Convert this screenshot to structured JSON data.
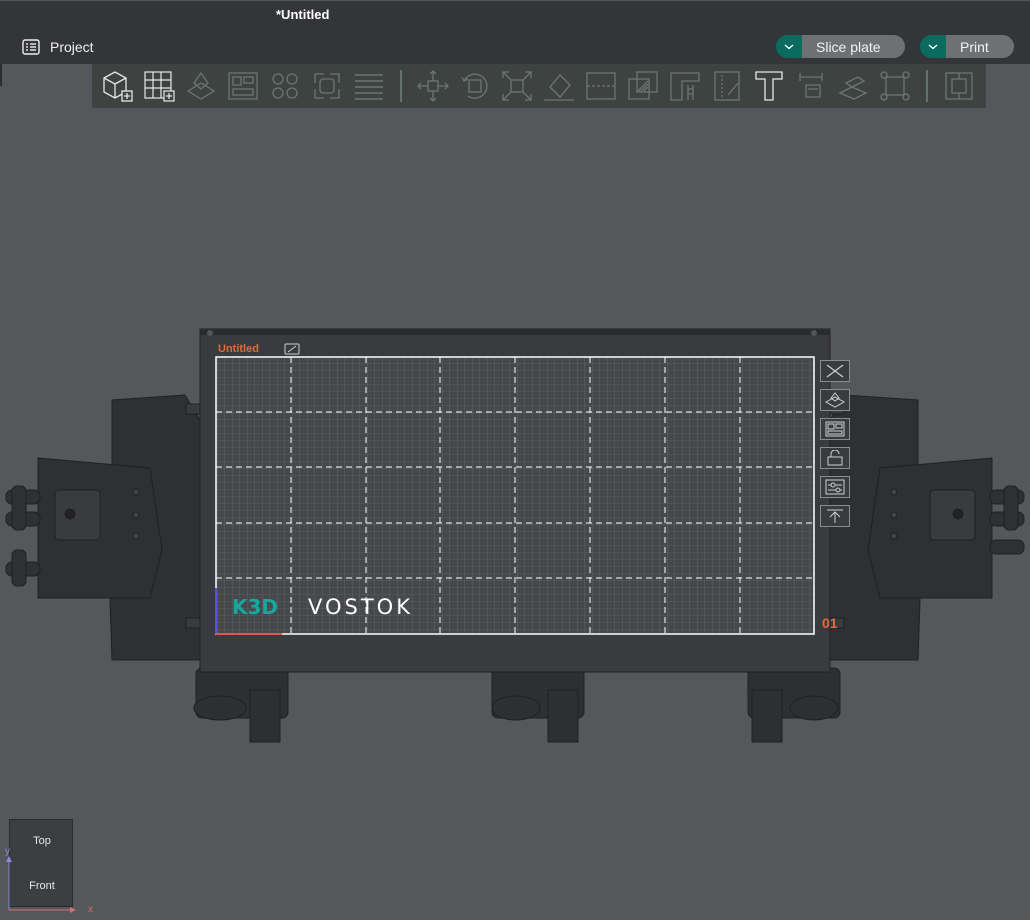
{
  "window": {
    "title": "*Untitled"
  },
  "menu": {
    "project_label": "Project"
  },
  "actions": {
    "slice_label": "Slice plate",
    "print_label": "Print"
  },
  "toolbar": {
    "icons": [
      "add-cube-icon",
      "add-plate-icon",
      "auto-orient-icon",
      "arrange-icon",
      "split-objects-icon",
      "split-parts-icon",
      "layers-list-icon",
      "move-icon",
      "rotate-icon",
      "scale-icon",
      "lay-on-face-icon",
      "cut-icon",
      "mesh-boolean-icon",
      "support-paint-icon",
      "seam-paint-icon",
      "text-icon",
      "measure-icon",
      "assembly-icon",
      "drill-icon",
      "assemble-view-icon"
    ]
  },
  "plate": {
    "name": "Untitled",
    "number": "01",
    "brand_prefix": "K3D",
    "brand_name": "VOSTOK",
    "side_tools": [
      "remove-plate-icon",
      "auto-orient-plate-icon",
      "arrange-plate-icon",
      "lock-plate-icon",
      "plate-settings-icon",
      "move-to-top-icon"
    ]
  },
  "view_cube": {
    "top_label": "Top",
    "front_label": "Front",
    "axis_x": "x",
    "axis_y": "y"
  },
  "colors": {
    "accent": "#0a6b5e",
    "plate_label": "#e6683a",
    "toolbar_bg": "#3e4241",
    "viewport_bg": "#55575a"
  }
}
